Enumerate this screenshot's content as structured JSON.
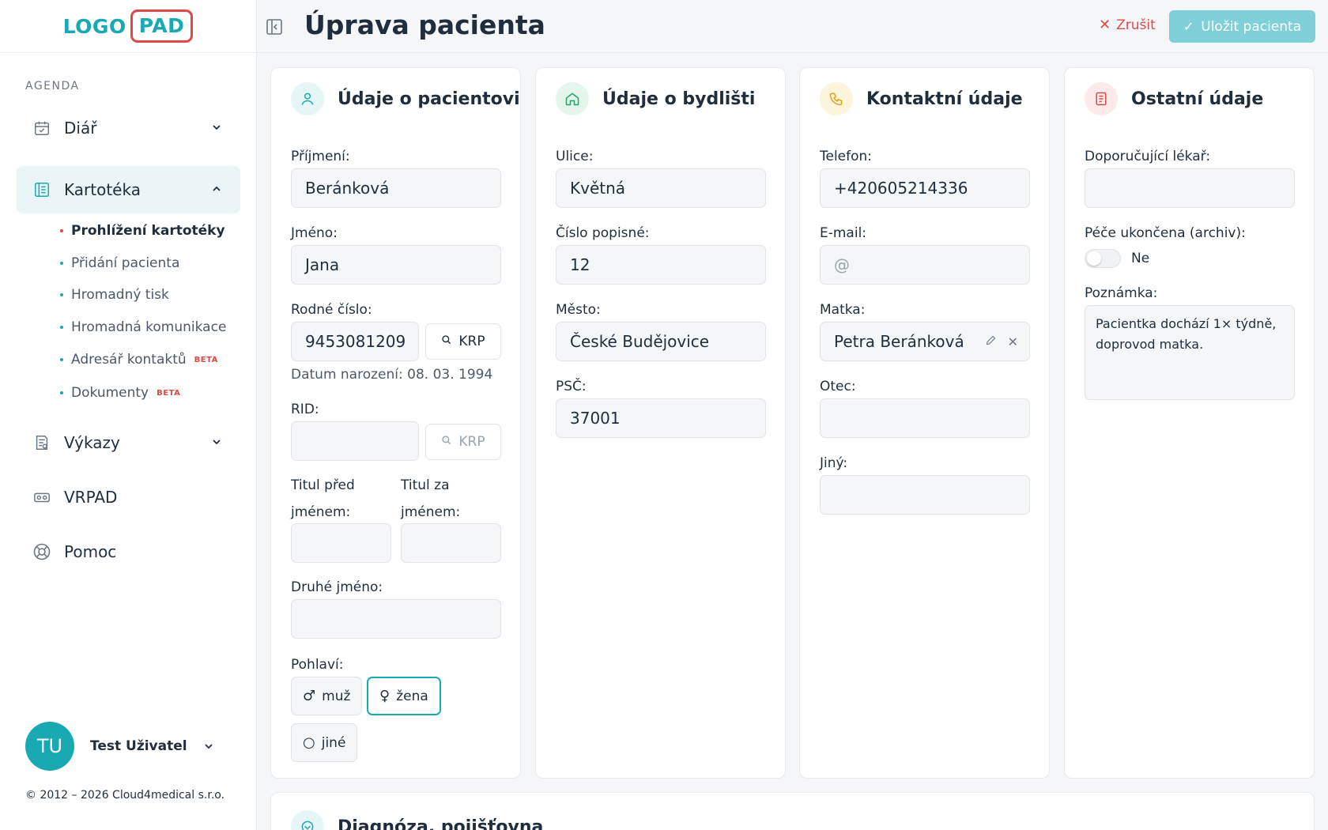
{
  "brand": {
    "logo_part1": "LOGO",
    "logo_part2": "PAD",
    "accent": "#19a9b3",
    "danger": "#e04848"
  },
  "sidebar": {
    "section": "AGENDA",
    "items": [
      {
        "label": "Diář",
        "icon": "calendar-icon"
      },
      {
        "label": "Kartotéka",
        "icon": "notebook-icon"
      },
      {
        "label": "Výkazy",
        "icon": "report-icon"
      },
      {
        "label": "VRPAD",
        "icon": "vr-headset-icon"
      },
      {
        "label": "Pomoc",
        "icon": "lifebuoy-icon"
      }
    ],
    "subitems": [
      {
        "label": "Prohlížení kartotéky"
      },
      {
        "label": "Přidání pacienta"
      },
      {
        "label": "Hromadný tisk"
      },
      {
        "label": "Hromadná komunikace"
      },
      {
        "label": "Adresář kontaktů",
        "badge": "BETA"
      },
      {
        "label": "Dokumenty",
        "badge": "BETA"
      }
    ],
    "user": {
      "initials": "TU",
      "name": "Test Uživatel"
    },
    "copyright": "© 2012 – 2026 Cloud4medical s.r.o."
  },
  "header": {
    "title": "Úprava pacienta",
    "cancel": "Zrušit",
    "save": "Uložit pacienta"
  },
  "patient": {
    "title": "Údaje o pacientovi",
    "surname_label": "Příjmení:",
    "surname": "Beránková",
    "name_label": "Jméno:",
    "name": "Jana",
    "birth_no_label": "Rodné číslo:",
    "birth_no": "9453081209",
    "krp": "KRP",
    "birth_date": "Datum narození: 08. 03. 1994",
    "rid_label": "RID:",
    "title_before_label_1": "Titul před",
    "title_before_label_2": "jménem:",
    "title_after_label_1": "Titul za",
    "title_after_label_2": "jménem:",
    "middle_name_label": "Druhé jméno:",
    "gender_label": "Pohlaví:",
    "gender_male": "muž",
    "gender_female": "žena",
    "gender_other": "jiné",
    "gender_selected": "žena"
  },
  "address": {
    "title": "Údaje o bydlišti",
    "street_label": "Ulice:",
    "street": "Květná",
    "number_label": "Číslo popisné:",
    "number": "12",
    "city_label": "Město:",
    "city": "České Budějovice",
    "zip_label": "PSČ:",
    "zip": "37001"
  },
  "contact": {
    "title": "Kontaktní údaje",
    "phone_label": "Telefon:",
    "phone": "+420605214336",
    "email_label": "E-mail:",
    "email_placeholder": "@",
    "mother_label": "Matka:",
    "mother": "Petra Beránková",
    "father_label": "Otec:",
    "other_label": "Jiný:"
  },
  "other": {
    "title": "Ostatní údaje",
    "doctor_label": "Doporučující lékař:",
    "archive_label": "Péče ukončena (archiv):",
    "archive_value": "Ne",
    "note_label": "Poznámka:",
    "note": "Pacientka dochází 1× týdně, doprovod matka."
  },
  "diagnosis": {
    "title": "Diagnóza, pojišťovna"
  }
}
